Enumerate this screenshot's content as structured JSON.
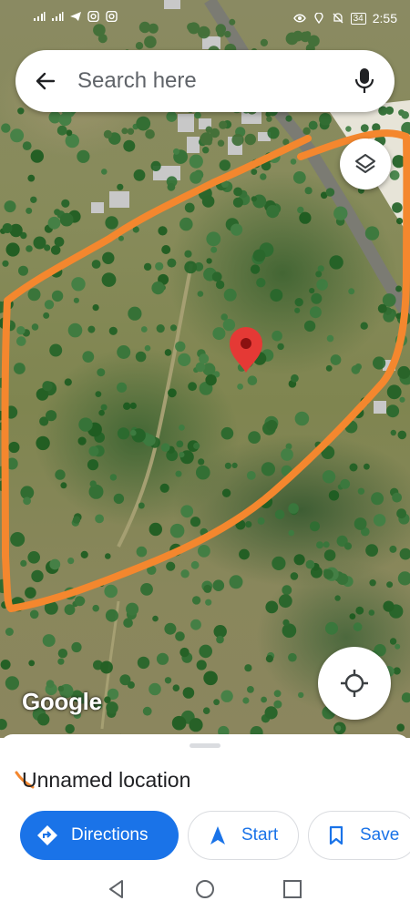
{
  "status_bar": {
    "time": "2:55",
    "battery": "34",
    "left_icons": [
      "signal-icon",
      "signal-icon",
      "telegram-icon",
      "instagram-icon",
      "instagram-icon"
    ],
    "right_icons": [
      "eye-icon",
      "location-icon",
      "bell-off-icon",
      "battery-icon"
    ]
  },
  "search": {
    "placeholder": "Search here"
  },
  "map": {
    "watermark": "Google",
    "outline_color": "#F4872E",
    "pin_color": "#E53935"
  },
  "place": {
    "name": "Unnamed location"
  },
  "actions": {
    "directions": "Directions",
    "start": "Start",
    "save": "Save"
  },
  "colors": {
    "accent": "#1A73E8"
  },
  "nav": {
    "icons": [
      "back-triangle-icon",
      "home-circle-icon",
      "recents-square-icon"
    ]
  }
}
